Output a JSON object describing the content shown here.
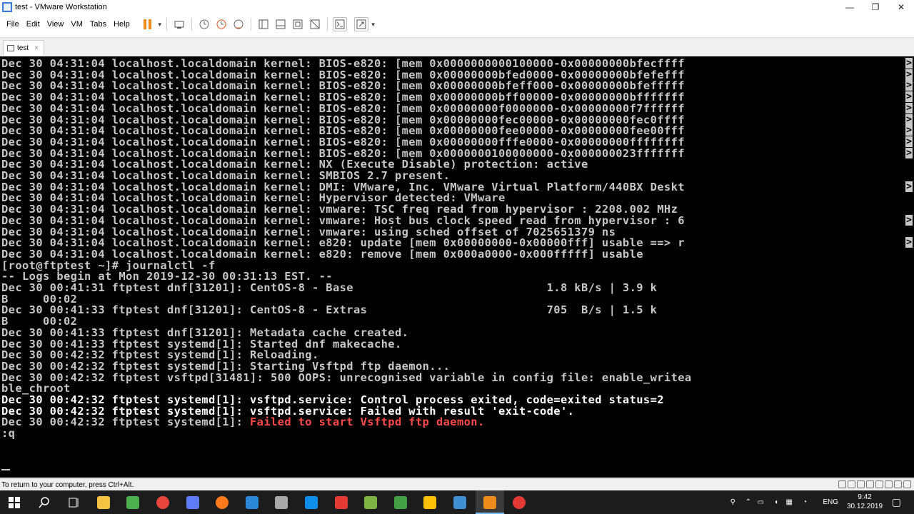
{
  "window": {
    "title": "test - VMware Workstation",
    "minimize_glyph": "—",
    "maximize_glyph": "❐",
    "close_glyph": "✕"
  },
  "menu": [
    "File",
    "Edit",
    "View",
    "VM",
    "Tabs",
    "Help"
  ],
  "tab": {
    "label": "test",
    "close_glyph": "×"
  },
  "console": {
    "lines": [
      {
        "text": "Dec 30 04:31:04 localhost.localdomain kernel: BIOS-e820: [mem 0x0000000000100000-0x00000000bfecffff",
        "trunc": true
      },
      {
        "text": "Dec 30 04:31:04 localhost.localdomain kernel: BIOS-e820: [mem 0x00000000bfed0000-0x00000000bfefefff",
        "trunc": true
      },
      {
        "text": "Dec 30 04:31:04 localhost.localdomain kernel: BIOS-e820: [mem 0x00000000bfeff000-0x00000000bfefffff",
        "trunc": true
      },
      {
        "text": "Dec 30 04:31:04 localhost.localdomain kernel: BIOS-e820: [mem 0x00000000bff00000-0x00000000bfffffff",
        "trunc": true
      },
      {
        "text": "Dec 30 04:31:04 localhost.localdomain kernel: BIOS-e820: [mem 0x00000000f0000000-0x00000000f7ffffff",
        "trunc": true
      },
      {
        "text": "Dec 30 04:31:04 localhost.localdomain kernel: BIOS-e820: [mem 0x00000000fec00000-0x00000000fec0ffff",
        "trunc": true
      },
      {
        "text": "Dec 30 04:31:04 localhost.localdomain kernel: BIOS-e820: [mem 0x00000000fee00000-0x00000000fee00fff",
        "trunc": true
      },
      {
        "text": "Dec 30 04:31:04 localhost.localdomain kernel: BIOS-e820: [mem 0x00000000fffe0000-0x00000000ffffffff",
        "trunc": true
      },
      {
        "text": "Dec 30 04:31:04 localhost.localdomain kernel: BIOS-e820: [mem 0x0000000100000000-0x000000023fffffff",
        "trunc": true
      },
      {
        "text": "Dec 30 04:31:04 localhost.localdomain kernel: NX (Execute Disable) protection: active",
        "trunc": false
      },
      {
        "text": "Dec 30 04:31:04 localhost.localdomain kernel: SMBIOS 2.7 present.",
        "trunc": false
      },
      {
        "text": "Dec 30 04:31:04 localhost.localdomain kernel: DMI: VMware, Inc. VMware Virtual Platform/440BX Deskt",
        "trunc": true
      },
      {
        "text": "Dec 30 04:31:04 localhost.localdomain kernel: Hypervisor detected: VMware",
        "trunc": false
      },
      {
        "text": "Dec 30 04:31:04 localhost.localdomain kernel: vmware: TSC freq read from hypervisor : 2208.002 MHz",
        "trunc": false
      },
      {
        "text": "Dec 30 04:31:04 localhost.localdomain kernel: vmware: Host bus clock speed read from hypervisor : 6",
        "trunc": true
      },
      {
        "text": "Dec 30 04:31:04 localhost.localdomain kernel: vmware: using sched offset of 7025651379 ns",
        "trunc": false
      },
      {
        "text": "Dec 30 04:31:04 localhost.localdomain kernel: e820: update [mem 0x00000000-0x00000fff] usable ==> r",
        "trunc": true
      },
      {
        "text": "Dec 30 04:31:04 localhost.localdomain kernel: e820: remove [mem 0x000a0000-0x000fffff] usable",
        "trunc": false
      },
      {
        "text": "[root@ftptest ~]# journalctl -f",
        "trunc": false
      },
      {
        "text": "-- Logs begin at Mon 2019-12-30 00:31:13 EST. --",
        "trunc": false
      },
      {
        "text": "Dec 30 00:41:31 ftptest dnf[31201]: CentOS-8 - Base                            1.8 kB/s | 3.9 k",
        "trunc": false
      },
      {
        "text": "B     00:02",
        "trunc": false
      },
      {
        "text": "Dec 30 00:41:33 ftptest dnf[31201]: CentOS-8 - Extras                          705  B/s | 1.5 k",
        "trunc": false
      },
      {
        "text": "B     00:02",
        "trunc": false
      },
      {
        "text": "Dec 30 00:41:33 ftptest dnf[31201]: Metadata cache created.",
        "trunc": false
      },
      {
        "text": "Dec 30 00:41:33 ftptest systemd[1]: Started dnf makecache.",
        "trunc": false
      },
      {
        "text": "Dec 30 00:42:32 ftptest systemd[1]: Reloading.",
        "trunc": false
      },
      {
        "text": "Dec 30 00:42:32 ftptest systemd[1]: Starting Vsftpd ftp daemon...",
        "trunc": false
      },
      {
        "text": "Dec 30 00:42:32 ftptest vsftpd[31481]: 500 OOPS: unrecognised variable in config file: enable_writea",
        "trunc": false
      },
      {
        "text": "ble_chroot",
        "trunc": false
      },
      {
        "text": "Dec 30 00:42:32 ftptest systemd[1]: vsftpd.service: Control process exited, code=exited status=2",
        "trunc": false,
        "white": true
      },
      {
        "text": "Dec 30 00:42:32 ftptest systemd[1]: vsftpd.service: Failed with result 'exit-code'.",
        "trunc": false,
        "white": true
      },
      {
        "text": "Dec 30 00:42:32 ftptest systemd[1]: ",
        "trunc": false,
        "red_suffix": "Failed to start Vsftpd ftp daemon."
      },
      {
        "text": ":q",
        "trunc": false
      }
    ],
    "trunc_glyph": ">"
  },
  "statusbar": {
    "message": "To return to your computer, press Ctrl+Alt."
  },
  "taskbar": {
    "language": "ENG",
    "time": "9:42",
    "date": "30.12.2019",
    "apps": [
      {
        "name": "start",
        "color": "#ffffff"
      },
      {
        "name": "search",
        "color": "#ffffff"
      },
      {
        "name": "task-view",
        "color": "#ffffff"
      },
      {
        "name": "file-explorer",
        "color": "#f6c343"
      },
      {
        "name": "app-5",
        "color": "#4caf50"
      },
      {
        "name": "chrome",
        "color": "#e8453c"
      },
      {
        "name": "app-7",
        "color": "#5c7cfa"
      },
      {
        "name": "firefox",
        "color": "#ff7a1a"
      },
      {
        "name": "app-9",
        "color": "#2b88d8"
      },
      {
        "name": "app-10",
        "color": "#aaaaaa"
      },
      {
        "name": "teamviewer",
        "color": "#0e8ee9"
      },
      {
        "name": "app-12",
        "color": "#e53935"
      },
      {
        "name": "app-13",
        "color": "#7cb342"
      },
      {
        "name": "app-14",
        "color": "#43a047"
      },
      {
        "name": "app-15",
        "color": "#ffc107"
      },
      {
        "name": "app-16",
        "color": "#3f8fd2"
      },
      {
        "name": "vmware",
        "color": "#f08c1c"
      },
      {
        "name": "recorder",
        "color": "#e53935"
      }
    ]
  }
}
